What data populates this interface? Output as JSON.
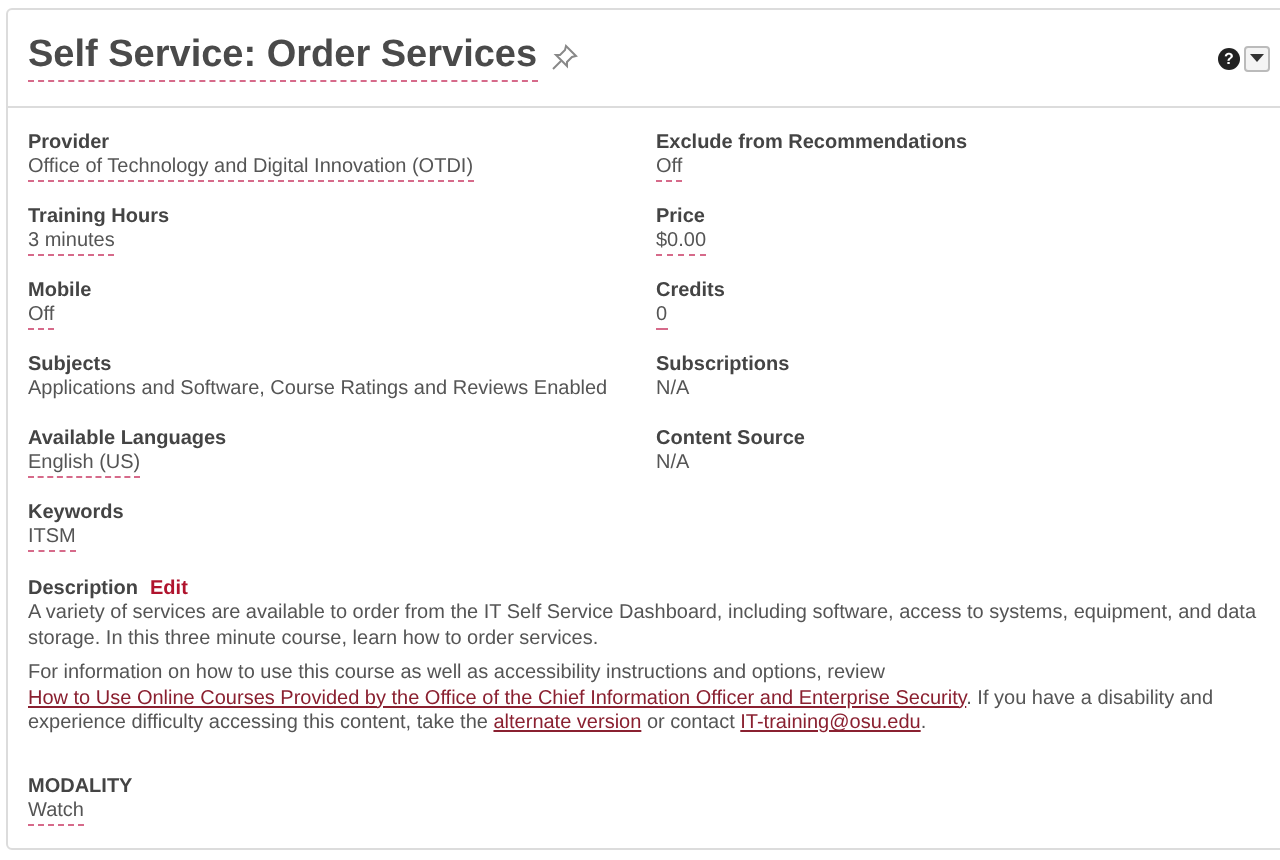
{
  "header": {
    "title": "Self Service: Order Services",
    "pinned": false,
    "help": "?"
  },
  "fields_left": [
    {
      "label": "Provider",
      "value": "Office of Technology and Digital Innovation (OTDI)",
      "editable": true
    },
    {
      "label": "Training Hours",
      "value": "3 minutes",
      "editable": true
    },
    {
      "label": "Mobile",
      "value": "Off",
      "editable": true
    },
    {
      "label": "Subjects",
      "value": "Applications and Software, Course Ratings and Reviews Enabled",
      "editable": false
    },
    {
      "label": "Available Languages",
      "value": "English (US)",
      "editable": true
    },
    {
      "label": "Keywords",
      "value": "ITSM",
      "editable": true
    }
  ],
  "fields_right": [
    {
      "label": "Exclude from Recommendations",
      "value": "Off",
      "editable": true
    },
    {
      "label": "Price",
      "value": "$0.00",
      "editable": true
    },
    {
      "label": "Credits",
      "value": "0",
      "editable": true
    },
    {
      "label": "Subscriptions",
      "value": "N/A",
      "editable": false
    },
    {
      "label": "Content Source",
      "value": "N/A",
      "editable": false
    }
  ],
  "description": {
    "label": "Description",
    "edit_link": "Edit",
    "paragraphs": [
      [
        {
          "kind": "text",
          "text": "A variety of services are available to order from the IT Self Service Dashboard, including software, access to systems, equipment, and data storage. In this three minute course, learn how to order services."
        }
      ],
      [
        {
          "kind": "text",
          "text": "For information on how to use this course as well as accessibility instructions and options, review "
        },
        {
          "kind": "link",
          "text": "How to Use Online Courses Provided by the Office of the Chief Information Officer and Enterprise Security"
        },
        {
          "kind": "text",
          "text": ". If you have a disability and experience difficulty accessing this content, take the "
        },
        {
          "kind": "link",
          "text": "alternate version"
        },
        {
          "kind": "text",
          "text": " or contact "
        },
        {
          "kind": "link",
          "text": "IT-training@osu.edu"
        },
        {
          "kind": "text",
          "text": "."
        }
      ]
    ]
  },
  "modality": {
    "label": "MODALITY",
    "value": "Watch",
    "editable": true
  }
}
